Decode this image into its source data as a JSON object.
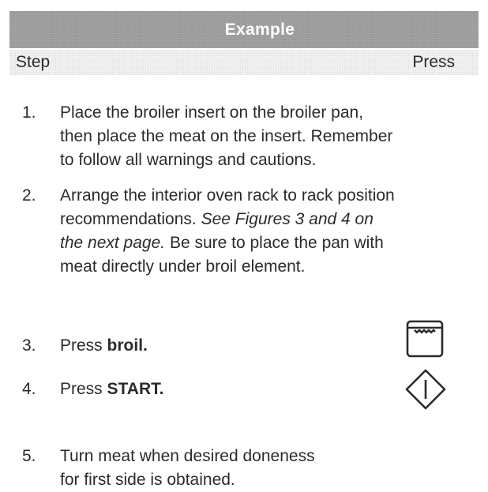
{
  "header": {
    "title": "Example"
  },
  "columns": {
    "step": "Step",
    "press": "Press"
  },
  "steps": [
    {
      "num": "1.",
      "lines": [
        "Place the broiler insert on the broiler pan,",
        "then place the meat on the insert. Remember",
        "to follow all warnings and cautions."
      ]
    },
    {
      "num": "2.",
      "lines": [
        "Arrange the interior oven rack to rack position",
        "recommendations.",
        "See Figures 3 and 4 on",
        "the next page.",
        "Be sure to place the pan with",
        "meat directly under broil element."
      ]
    },
    {
      "num": "3.",
      "prefix": "Press",
      "bold": "broil."
    },
    {
      "num": "4.",
      "prefix": "Press",
      "bold": "START."
    },
    {
      "num": "5.",
      "lines": [
        "Turn meat when desired doneness",
        "for first side is obtained."
      ]
    }
  ],
  "icons": {
    "step3": "broil-key-icon",
    "step4": "start-key-icon"
  }
}
